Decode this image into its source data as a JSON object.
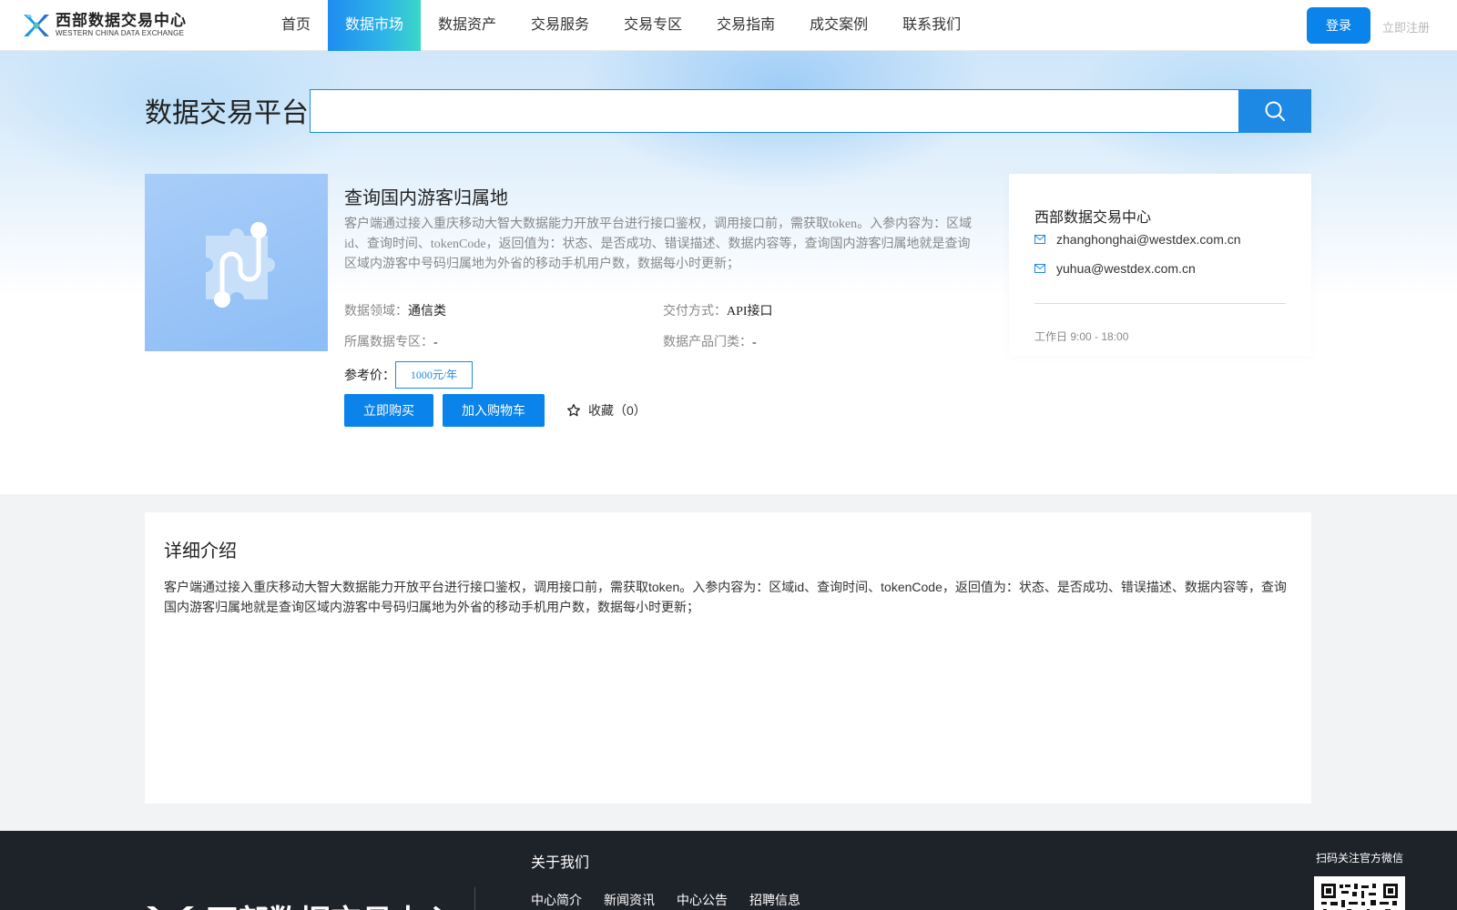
{
  "header": {
    "logo": {
      "cn": "西部数据交易中心",
      "en": "WESTERN CHINA DATA EXCHANGE"
    },
    "nav": [
      {
        "label": "首页",
        "active": false
      },
      {
        "label": "数据市场",
        "active": true
      },
      {
        "label": "数据资产",
        "active": false
      },
      {
        "label": "交易服务",
        "active": false
      },
      {
        "label": "交易专区",
        "active": false
      },
      {
        "label": "交易指南",
        "active": false
      },
      {
        "label": "成交案例",
        "active": false
      },
      {
        "label": "联系我们",
        "active": false
      }
    ],
    "login_label": "登录",
    "register_label": "立即注册"
  },
  "hero": {
    "title": "数据交易平台",
    "search": {
      "value": "",
      "placeholder": ""
    }
  },
  "product": {
    "title": "查询国内游客归属地",
    "description": "客户端通过接入重庆移动大智大数据能力开放平台进行接口鉴权，调用接口前，需获取token。入参内容为：区域id、查询时间、tokenCode，返回值为：状态、是否成功、错误描述、数据内容等，查询国内游客归属地就是查询区域内游客中号码归属地为外省的移动手机用户数，数据每小时更新；",
    "attributes": {
      "domain": {
        "key": "数据领域：",
        "value": "通信类"
      },
      "delivery": {
        "key": "交付方式：",
        "value": "API接口"
      },
      "zone": {
        "key": "所属数据专区：",
        "value": "-"
      },
      "category": {
        "key": "数据产品门类：",
        "value": "-"
      }
    },
    "price_label": "参考价：",
    "price": "1000元/年",
    "buy_label": "立即购买",
    "cart_label": "加入购物车",
    "favorite_label": "收藏（0）"
  },
  "contact": {
    "name": "西部数据交易中心",
    "emails": [
      "zhanghonghai@westdex.com.cn",
      "yuhua@westdex.com.cn"
    ],
    "hours": "工作日 9:00 - 18:00"
  },
  "detail": {
    "title": "详细介绍",
    "text": "客户端通过接入重庆移动大智大数据能力开放平台进行接口鉴权，调用接口前，需获取token。入参内容为：区域id、查询时间、tokenCode，返回值为：状态、是否成功、错误描述、数据内容等，查询国内游客归属地就是查询区域内游客中号码归属地为外省的移动手机用户数，数据每小时更新；"
  },
  "footer": {
    "logo_text": "西部数据交易中心",
    "about_title": "关于我们",
    "links": [
      "中心简介",
      "新闻资讯",
      "中心公告",
      "招聘信息"
    ],
    "qr_label": "扫码关注官方微信"
  },
  "icons": {
    "search": "search-icon",
    "star": "star-outline-icon",
    "mail": "mail-icon",
    "product": "puzzle-api-icon",
    "qr": "qr-code-icon"
  },
  "colors": {
    "primary": "#0a84ea",
    "nav_active_start": "#1e8cf0",
    "nav_active_end": "#3ad6c8",
    "footer_bg": "#1e2229"
  }
}
